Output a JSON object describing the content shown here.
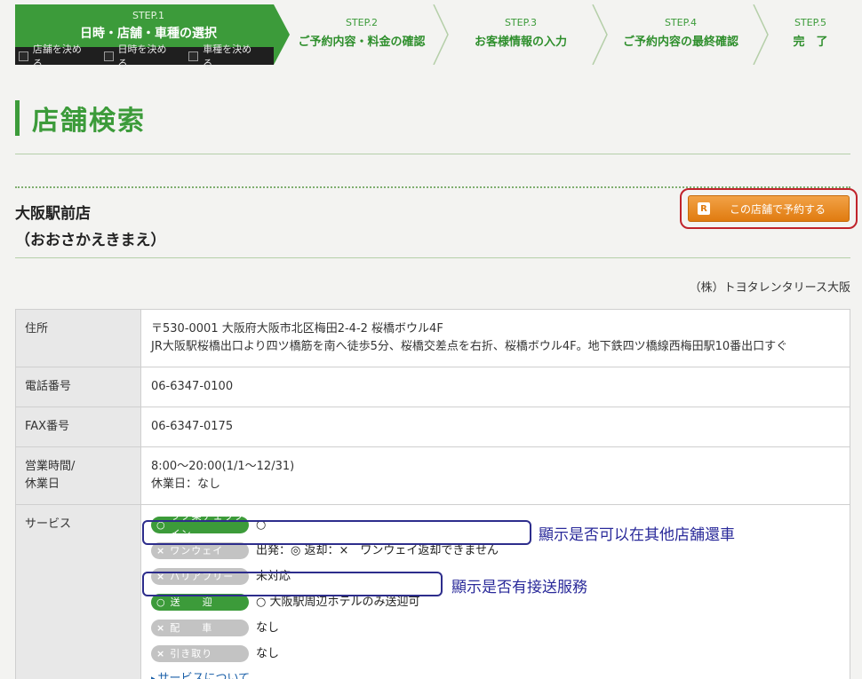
{
  "steps": [
    {
      "label": "STEP.1",
      "title": "日時・店舗・車種の選択"
    },
    {
      "label": "STEP.2",
      "title": "ご予約内容・料金の確認"
    },
    {
      "label": "STEP.3",
      "title": "お客様情報の入力"
    },
    {
      "label": "STEP.4",
      "title": "ご予約内容の最終確認"
    },
    {
      "label": "STEP.5",
      "title": "完　了"
    }
  ],
  "substeps": [
    "店舗を決める",
    "日時を決める",
    "車種を決める"
  ],
  "page_title": "店舗検索",
  "store": {
    "name": "大阪駅前店",
    "kana": "（おおさかえきまえ）",
    "company": "（株）トヨタレンタリース大阪"
  },
  "reserve": {
    "icon": "R",
    "label": "この店舗で予約する"
  },
  "table": {
    "address_label": "住所",
    "address_line1": "〒530-0001 大阪府大阪市北区梅田2-4-2 桜橋ボウル4F",
    "address_line2": "JR大阪駅桜橋出口より四ツ橋筋を南へ徒歩5分、桜橋交差点を右折、桜橋ボウル4F。地下鉄四ツ橋線西梅田駅10番出口すぐ",
    "tel_label": "電話番号",
    "tel": "06-6347-0100",
    "fax_label": "FAX番号",
    "fax": "06-6347-0175",
    "hours_label1": "営業時間/",
    "hours_label2": "休業日",
    "hours": "8:00〜20:00(1/1〜12/31)",
    "holiday": "休業日：なし",
    "service_label": "サービス"
  },
  "services": [
    {
      "mark": "○",
      "name": "ラク楽チェックイン",
      "value": "○",
      "on": true
    },
    {
      "mark": "×",
      "name": "ワンウェイ",
      "value": "出発：◎ 返却：×　ワンウェイ返却できません",
      "on": false
    },
    {
      "mark": "×",
      "name": "バリアフリー",
      "value": "未対応",
      "on": false
    },
    {
      "mark": "○",
      "name": "送　　迎",
      "value": "○ 大阪駅周辺ホテルのみ送迎可",
      "on": true
    },
    {
      "mark": "×",
      "name": "配　　車",
      "value": "なし",
      "on": false
    },
    {
      "mark": "×",
      "name": "引き取り",
      "value": "なし",
      "on": false
    }
  ],
  "service_link": "サービスについて",
  "annotations": {
    "oneway_note": "顯示是否可以在其他店舖還車",
    "pickup_note": "顯示是否有接送服務"
  },
  "colors": {
    "accent": "#3c9b3a",
    "orange": "#e07b10",
    "highlight_red": "#c0232b",
    "highlight_blue": "#2d2d8c"
  }
}
